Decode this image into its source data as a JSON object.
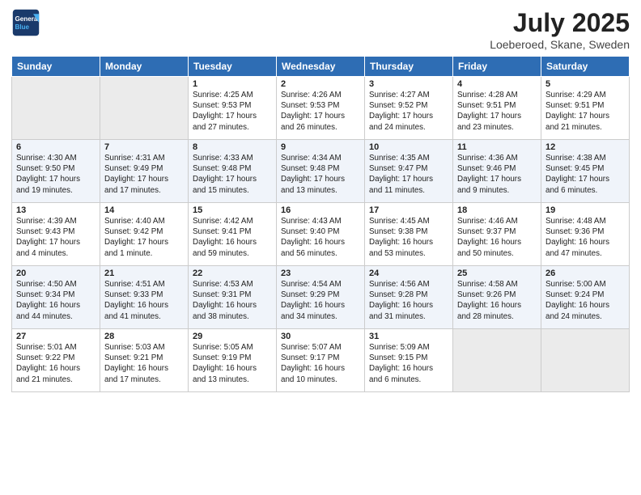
{
  "header": {
    "logo_general": "General",
    "logo_blue": "Blue",
    "month": "July 2025",
    "location": "Loeberoed, Skane, Sweden"
  },
  "weekdays": [
    "Sunday",
    "Monday",
    "Tuesday",
    "Wednesday",
    "Thursday",
    "Friday",
    "Saturday"
  ],
  "rows": [
    [
      {
        "day": "",
        "info": ""
      },
      {
        "day": "",
        "info": ""
      },
      {
        "day": "1",
        "info": "Sunrise: 4:25 AM\nSunset: 9:53 PM\nDaylight: 17 hours and 27 minutes."
      },
      {
        "day": "2",
        "info": "Sunrise: 4:26 AM\nSunset: 9:53 PM\nDaylight: 17 hours and 26 minutes."
      },
      {
        "day": "3",
        "info": "Sunrise: 4:27 AM\nSunset: 9:52 PM\nDaylight: 17 hours and 24 minutes."
      },
      {
        "day": "4",
        "info": "Sunrise: 4:28 AM\nSunset: 9:51 PM\nDaylight: 17 hours and 23 minutes."
      },
      {
        "day": "5",
        "info": "Sunrise: 4:29 AM\nSunset: 9:51 PM\nDaylight: 17 hours and 21 minutes."
      }
    ],
    [
      {
        "day": "6",
        "info": "Sunrise: 4:30 AM\nSunset: 9:50 PM\nDaylight: 17 hours and 19 minutes."
      },
      {
        "day": "7",
        "info": "Sunrise: 4:31 AM\nSunset: 9:49 PM\nDaylight: 17 hours and 17 minutes."
      },
      {
        "day": "8",
        "info": "Sunrise: 4:33 AM\nSunset: 9:48 PM\nDaylight: 17 hours and 15 minutes."
      },
      {
        "day": "9",
        "info": "Sunrise: 4:34 AM\nSunset: 9:48 PM\nDaylight: 17 hours and 13 minutes."
      },
      {
        "day": "10",
        "info": "Sunrise: 4:35 AM\nSunset: 9:47 PM\nDaylight: 17 hours and 11 minutes."
      },
      {
        "day": "11",
        "info": "Sunrise: 4:36 AM\nSunset: 9:46 PM\nDaylight: 17 hours and 9 minutes."
      },
      {
        "day": "12",
        "info": "Sunrise: 4:38 AM\nSunset: 9:45 PM\nDaylight: 17 hours and 6 minutes."
      }
    ],
    [
      {
        "day": "13",
        "info": "Sunrise: 4:39 AM\nSunset: 9:43 PM\nDaylight: 17 hours and 4 minutes."
      },
      {
        "day": "14",
        "info": "Sunrise: 4:40 AM\nSunset: 9:42 PM\nDaylight: 17 hours and 1 minute."
      },
      {
        "day": "15",
        "info": "Sunrise: 4:42 AM\nSunset: 9:41 PM\nDaylight: 16 hours and 59 minutes."
      },
      {
        "day": "16",
        "info": "Sunrise: 4:43 AM\nSunset: 9:40 PM\nDaylight: 16 hours and 56 minutes."
      },
      {
        "day": "17",
        "info": "Sunrise: 4:45 AM\nSunset: 9:38 PM\nDaylight: 16 hours and 53 minutes."
      },
      {
        "day": "18",
        "info": "Sunrise: 4:46 AM\nSunset: 9:37 PM\nDaylight: 16 hours and 50 minutes."
      },
      {
        "day": "19",
        "info": "Sunrise: 4:48 AM\nSunset: 9:36 PM\nDaylight: 16 hours and 47 minutes."
      }
    ],
    [
      {
        "day": "20",
        "info": "Sunrise: 4:50 AM\nSunset: 9:34 PM\nDaylight: 16 hours and 44 minutes."
      },
      {
        "day": "21",
        "info": "Sunrise: 4:51 AM\nSunset: 9:33 PM\nDaylight: 16 hours and 41 minutes."
      },
      {
        "day": "22",
        "info": "Sunrise: 4:53 AM\nSunset: 9:31 PM\nDaylight: 16 hours and 38 minutes."
      },
      {
        "day": "23",
        "info": "Sunrise: 4:54 AM\nSunset: 9:29 PM\nDaylight: 16 hours and 34 minutes."
      },
      {
        "day": "24",
        "info": "Sunrise: 4:56 AM\nSunset: 9:28 PM\nDaylight: 16 hours and 31 minutes."
      },
      {
        "day": "25",
        "info": "Sunrise: 4:58 AM\nSunset: 9:26 PM\nDaylight: 16 hours and 28 minutes."
      },
      {
        "day": "26",
        "info": "Sunrise: 5:00 AM\nSunset: 9:24 PM\nDaylight: 16 hours and 24 minutes."
      }
    ],
    [
      {
        "day": "27",
        "info": "Sunrise: 5:01 AM\nSunset: 9:22 PM\nDaylight: 16 hours and 21 minutes."
      },
      {
        "day": "28",
        "info": "Sunrise: 5:03 AM\nSunset: 9:21 PM\nDaylight: 16 hours and 17 minutes."
      },
      {
        "day": "29",
        "info": "Sunrise: 5:05 AM\nSunset: 9:19 PM\nDaylight: 16 hours and 13 minutes."
      },
      {
        "day": "30",
        "info": "Sunrise: 5:07 AM\nSunset: 9:17 PM\nDaylight: 16 hours and 10 minutes."
      },
      {
        "day": "31",
        "info": "Sunrise: 5:09 AM\nSunset: 9:15 PM\nDaylight: 16 hours and 6 minutes."
      },
      {
        "day": "",
        "info": ""
      },
      {
        "day": "",
        "info": ""
      }
    ]
  ],
  "row_shading": [
    "white",
    "shade",
    "white",
    "shade",
    "white"
  ]
}
